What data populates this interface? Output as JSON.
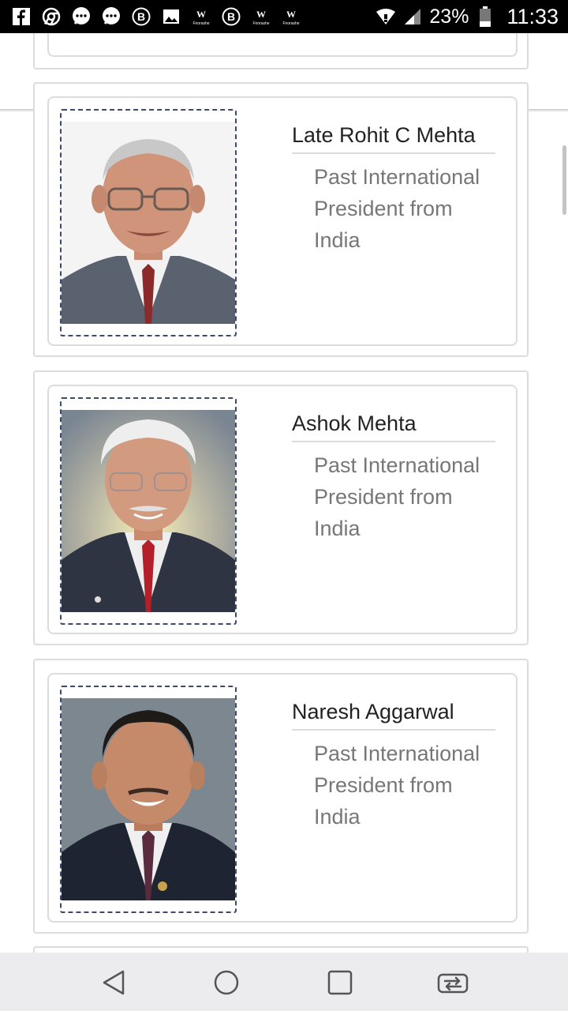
{
  "status_bar": {
    "battery_percent": "23%",
    "time": "11:33",
    "notification_icons": [
      "facebook-icon",
      "chrome-icon",
      "messaging-icon",
      "messaging-icon",
      "b-app-icon",
      "gallery-icon",
      "w-app-icon",
      "b-app-icon",
      "w-app-icon",
      "w-app-icon"
    ],
    "w_app_sublabel": "Fnorashe"
  },
  "cards": [
    {
      "name": "Late Rohit C Mehta",
      "description": "Past International President from India"
    },
    {
      "name": "Ashok Mehta",
      "description": "Past International President from India"
    },
    {
      "name": "Naresh Aggarwal",
      "description": "Past International President from India"
    }
  ],
  "colors": {
    "card_border": "#dcdcdc",
    "photo_border": "#3b4a6b",
    "name_text": "#222222",
    "description_text": "#777777",
    "nav_bar_bg": "#ececee"
  }
}
